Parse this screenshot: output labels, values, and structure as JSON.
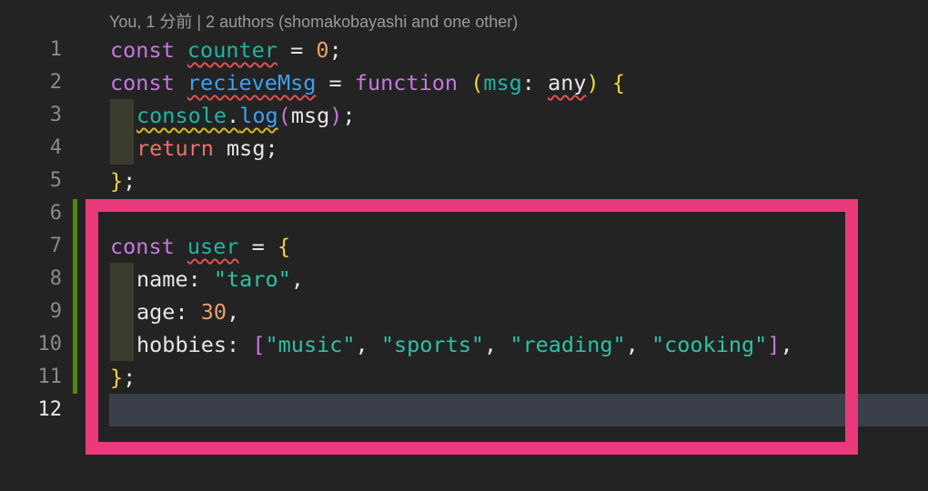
{
  "codelens": "You, 1 分前 | 2 authors (shomakobayashi and one other)",
  "line_numbers": [
    "1",
    "2",
    "3",
    "4",
    "5",
    "6",
    "7",
    "8",
    "9",
    "10",
    "11",
    "12"
  ],
  "code": {
    "l1": {
      "kw": "const",
      "sp1": " ",
      "id": "counter",
      "op": " = ",
      "num": "0",
      "semi": ";"
    },
    "l2": {
      "kw": "const",
      "sp1": " ",
      "id": "recieveMsg",
      "op": " = ",
      "fn_kw": "function",
      "sp2": " ",
      "paren_open": "(",
      "param": "msg",
      "colon": ": ",
      "type": "any",
      "paren_close": ")",
      "sp3": " ",
      "brace": "{"
    },
    "l3": {
      "obj": "console",
      "dot": ".",
      "method": "log",
      "paren_open": "(",
      "arg": "msg",
      "paren_close": ")",
      "semi": ";"
    },
    "l4": {
      "kw": "return",
      "rest": " msg;"
    },
    "l5": {
      "brace": "}",
      "semi": ";"
    },
    "l7": {
      "kw": "const",
      "sp1": " ",
      "id": "user",
      "op": " = ",
      "brace": "{"
    },
    "l8": {
      "key": "name: ",
      "str": "\"taro\"",
      "comma": ","
    },
    "l9": {
      "key": "age: ",
      "num": "30",
      "comma": ","
    },
    "l10": {
      "key": "hobbies: ",
      "bracket_open": "[",
      "s1": "\"music\"",
      "c1": ", ",
      "s2": "\"sports\"",
      "c2": ", ",
      "s3": "\"reading\"",
      "c3": ", ",
      "s4": "\"cooking\"",
      "bracket_close": "]",
      "comma": ","
    },
    "l11": {
      "brace": "}",
      "semi": ";"
    }
  },
  "colors": {
    "background": "#232323",
    "highlight_border": "#ea3a7b",
    "modified_gutter": "#4f8a10",
    "cursor_line": "#3a3f4a"
  }
}
